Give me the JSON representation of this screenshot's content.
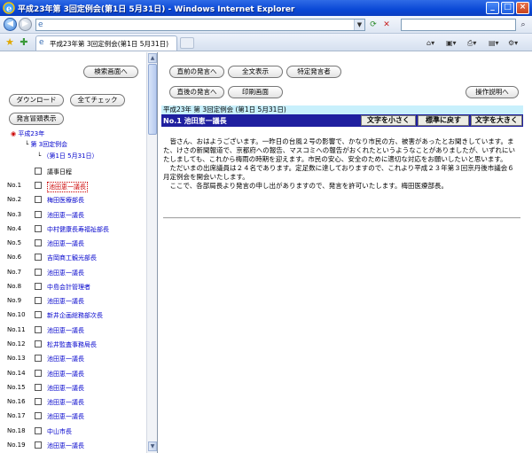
{
  "window": {
    "title": "平成23年第 3回定例会(第1日 5月31日) - Windows Internet Explorer",
    "minimize": "_",
    "maximize": "□",
    "close": "×"
  },
  "tab": {
    "label": "平成23年第 3回定例会(第1日 5月31日)"
  },
  "left": {
    "search_screen_button": "検索画面へ",
    "download_button": "ダウンロード",
    "check_all_button": "全てチェック",
    "speaker_list_button": "発言冒頭表示",
    "tree_year": "平成23年",
    "tree_session": "第 3回定例会",
    "tree_day": "（第1日 5月31日）",
    "agenda": "議事日程",
    "items": [
      {
        "no": "No.1",
        "name": "池田恵一議長"
      },
      {
        "no": "No.2",
        "name": "梅田医療部長"
      },
      {
        "no": "No.3",
        "name": "池田恵一議長"
      },
      {
        "no": "No.4",
        "name": "中村健康長寿福祉部長"
      },
      {
        "no": "No.5",
        "name": "池田恵一議長"
      },
      {
        "no": "No.6",
        "name": "吉岡商工観光部長"
      },
      {
        "no": "No.7",
        "name": "池田恵一議長"
      },
      {
        "no": "No.8",
        "name": "中島会計管理者"
      },
      {
        "no": "No.9",
        "name": "池田恵一議長"
      },
      {
        "no": "No.10",
        "name": "新井企画総務部次長"
      },
      {
        "no": "No.11",
        "name": "池田恵一議長"
      },
      {
        "no": "No.12",
        "name": "松井監査事務局長"
      },
      {
        "no": "No.13",
        "name": "池田恵一議長"
      },
      {
        "no": "No.14",
        "name": "池田恵一議長"
      },
      {
        "no": "No.15",
        "name": "池田恵一議長"
      },
      {
        "no": "No.16",
        "name": "池田恵一議長"
      },
      {
        "no": "No.17",
        "name": "池田恵一議長"
      },
      {
        "no": "No.18",
        "name": "中山市長"
      },
      {
        "no": "No.19",
        "name": "池田恵一議長"
      }
    ]
  },
  "right": {
    "prev_button": "直前の発言へ",
    "full_text_button": "全文表示",
    "specific_speaker_button": "特定発言者",
    "next_button": "直後の発言へ",
    "print_button": "印刷画面",
    "help_button": "操作説明へ",
    "session_header": "平成23年 第 3回定例会 (第1日 5月31日)",
    "speaker": "No.1 池田恵一議長",
    "font_small": "文字を小さく",
    "font_reset": "標準に戻す",
    "font_large": "文字を大きく",
    "speech_para1": "皆さん、おはようございます。一昨日の台風２号の影響で、かなり市民の方、被害があったとお聞きしています。また、けさの新聞報道で、京都府への報告、マスコミへの報告がおくれたというようなことがありましたが、いずれにいたしましても、これから梅雨の時期を迎えます。市民の安心、安全のために適切な対応をお願いしたいと思います。",
    "speech_para2": "ただいまの出席議員は２４名であります。定足数に達しておりますので、これより平成２３年第３回京丹後市議会６月定例会を開会いたします。",
    "speech_para3": "ここで、各部局長より発言の申し出がありますので、発言を許可いたします。梅田医療部長。"
  }
}
